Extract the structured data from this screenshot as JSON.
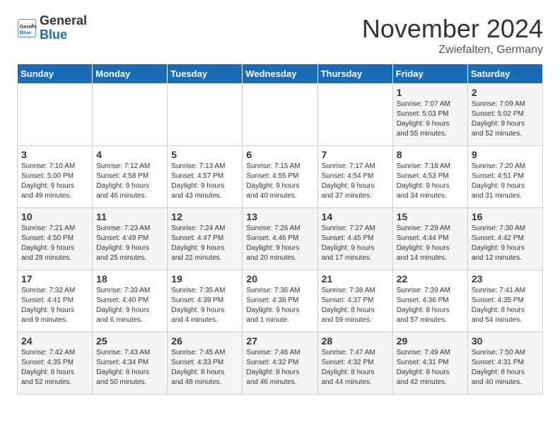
{
  "header": {
    "logo_line1": "General",
    "logo_line2": "Blue",
    "month": "November 2024",
    "location": "Zwiefalten, Germany"
  },
  "weekdays": [
    "Sunday",
    "Monday",
    "Tuesday",
    "Wednesday",
    "Thursday",
    "Friday",
    "Saturday"
  ],
  "weeks": [
    [
      {
        "day": "",
        "info": ""
      },
      {
        "day": "",
        "info": ""
      },
      {
        "day": "",
        "info": ""
      },
      {
        "day": "",
        "info": ""
      },
      {
        "day": "",
        "info": ""
      },
      {
        "day": "1",
        "info": "Sunrise: 7:07 AM\nSunset: 5:03 PM\nDaylight: 9 hours\nand 55 minutes."
      },
      {
        "day": "2",
        "info": "Sunrise: 7:09 AM\nSunset: 5:02 PM\nDaylight: 9 hours\nand 52 minutes."
      }
    ],
    [
      {
        "day": "3",
        "info": "Sunrise: 7:10 AM\nSunset: 5:00 PM\nDaylight: 9 hours\nand 49 minutes."
      },
      {
        "day": "4",
        "info": "Sunrise: 7:12 AM\nSunset: 4:58 PM\nDaylight: 9 hours\nand 46 minutes."
      },
      {
        "day": "5",
        "info": "Sunrise: 7:13 AM\nSunset: 4:57 PM\nDaylight: 9 hours\nand 43 minutes."
      },
      {
        "day": "6",
        "info": "Sunrise: 7:15 AM\nSunset: 4:55 PM\nDaylight: 9 hours\nand 40 minutes."
      },
      {
        "day": "7",
        "info": "Sunrise: 7:17 AM\nSunset: 4:54 PM\nDaylight: 9 hours\nand 37 minutes."
      },
      {
        "day": "8",
        "info": "Sunrise: 7:18 AM\nSunset: 4:53 PM\nDaylight: 9 hours\nand 34 minutes."
      },
      {
        "day": "9",
        "info": "Sunrise: 7:20 AM\nSunset: 4:51 PM\nDaylight: 9 hours\nand 31 minutes."
      }
    ],
    [
      {
        "day": "10",
        "info": "Sunrise: 7:21 AM\nSunset: 4:50 PM\nDaylight: 9 hours\nand 28 minutes."
      },
      {
        "day": "11",
        "info": "Sunrise: 7:23 AM\nSunset: 4:49 PM\nDaylight: 9 hours\nand 25 minutes."
      },
      {
        "day": "12",
        "info": "Sunrise: 7:24 AM\nSunset: 4:47 PM\nDaylight: 9 hours\nand 22 minutes."
      },
      {
        "day": "13",
        "info": "Sunrise: 7:26 AM\nSunset: 4:46 PM\nDaylight: 9 hours\nand 20 minutes."
      },
      {
        "day": "14",
        "info": "Sunrise: 7:27 AM\nSunset: 4:45 PM\nDaylight: 9 hours\nand 17 minutes."
      },
      {
        "day": "15",
        "info": "Sunrise: 7:29 AM\nSunset: 4:44 PM\nDaylight: 9 hours\nand 14 minutes."
      },
      {
        "day": "16",
        "info": "Sunrise: 7:30 AM\nSunset: 4:42 PM\nDaylight: 9 hours\nand 12 minutes."
      }
    ],
    [
      {
        "day": "17",
        "info": "Sunrise: 7:32 AM\nSunset: 4:41 PM\nDaylight: 9 hours\nand 9 minutes."
      },
      {
        "day": "18",
        "info": "Sunrise: 7:33 AM\nSunset: 4:40 PM\nDaylight: 9 hours\nand 6 minutes."
      },
      {
        "day": "19",
        "info": "Sunrise: 7:35 AM\nSunset: 4:39 PM\nDaylight: 9 hours\nand 4 minutes."
      },
      {
        "day": "20",
        "info": "Sunrise: 7:36 AM\nSunset: 4:38 PM\nDaylight: 9 hours\nand 1 minute."
      },
      {
        "day": "21",
        "info": "Sunrise: 7:38 AM\nSunset: 4:37 PM\nDaylight: 8 hours\nand 59 minutes."
      },
      {
        "day": "22",
        "info": "Sunrise: 7:39 AM\nSunset: 4:36 PM\nDaylight: 8 hours\nand 57 minutes."
      },
      {
        "day": "23",
        "info": "Sunrise: 7:41 AM\nSunset: 4:35 PM\nDaylight: 8 hours\nand 54 minutes."
      }
    ],
    [
      {
        "day": "24",
        "info": "Sunrise: 7:42 AM\nSunset: 4:35 PM\nDaylight: 8 hours\nand 52 minutes."
      },
      {
        "day": "25",
        "info": "Sunrise: 7:43 AM\nSunset: 4:34 PM\nDaylight: 8 hours\nand 50 minutes."
      },
      {
        "day": "26",
        "info": "Sunrise: 7:45 AM\nSunset: 4:33 PM\nDaylight: 8 hours\nand 48 minutes."
      },
      {
        "day": "27",
        "info": "Sunrise: 7:46 AM\nSunset: 4:32 PM\nDaylight: 8 hours\nand 46 minutes."
      },
      {
        "day": "28",
        "info": "Sunrise: 7:47 AM\nSunset: 4:32 PM\nDaylight: 8 hours\nand 44 minutes."
      },
      {
        "day": "29",
        "info": "Sunrise: 7:49 AM\nSunset: 4:31 PM\nDaylight: 8 hours\nand 42 minutes."
      },
      {
        "day": "30",
        "info": "Sunrise: 7:50 AM\nSunset: 4:31 PM\nDaylight: 8 hours\nand 40 minutes."
      }
    ]
  ]
}
